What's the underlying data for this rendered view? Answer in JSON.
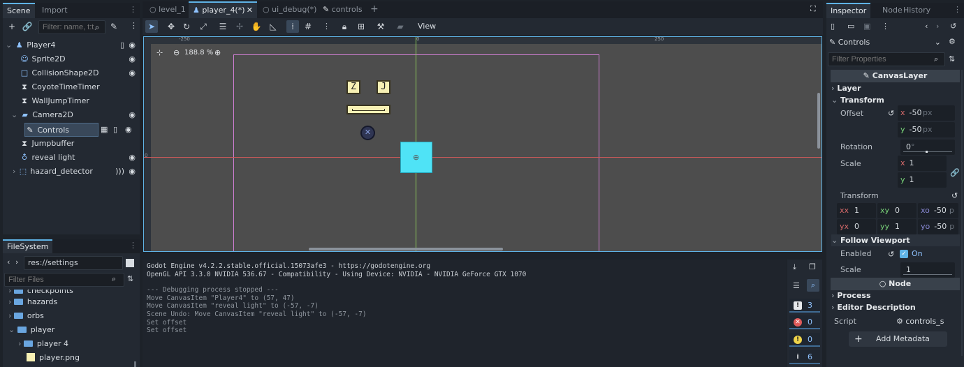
{
  "left_dock": {
    "tabs": [
      "Scene",
      "Import"
    ],
    "filter_placeholder": "Filter: name, t:t",
    "tree": [
      {
        "label": "Player4",
        "icon": "character-body-icon"
      },
      {
        "label": "Sprite2D",
        "icon": "sprite-icon"
      },
      {
        "label": "CollisionShape2D",
        "icon": "collision-shape-icon"
      },
      {
        "label": "CoyoteTimeTimer",
        "icon": "timer-icon"
      },
      {
        "label": "WallJumpTimer",
        "icon": "timer-icon"
      },
      {
        "label": "Camera2D",
        "icon": "camera-icon"
      },
      {
        "label": "Controls",
        "icon": "canvas-layer-icon"
      },
      {
        "label": "Jumpbuffer",
        "icon": "timer-icon"
      },
      {
        "label": "reveal light",
        "icon": "point-light-icon"
      },
      {
        "label": "hazard_detector",
        "icon": "area-icon"
      }
    ]
  },
  "filesystem": {
    "tab": "FileSystem",
    "path": "res://settings",
    "filter_placeholder": "Filter Files",
    "items": [
      {
        "label": "checkpoints"
      },
      {
        "label": "hazards"
      },
      {
        "label": "orbs"
      },
      {
        "label": "player"
      },
      {
        "label": "player 4"
      },
      {
        "label": "player.png"
      }
    ]
  },
  "editor_tabs": [
    "level_1",
    "player_4(*)",
    "ui_debug(*)",
    "controls"
  ],
  "toolbar": {
    "view_label": "View"
  },
  "viewport": {
    "zoom": "188.8 %",
    "ruler_labels": [
      "-250",
      "0",
      "250"
    ],
    "ruler_side": "0",
    "keys": [
      "Z",
      "J"
    ]
  },
  "output": {
    "lines": [
      "Godot Engine v4.2.2.stable.official.15073afe3 - https://godotengine.org",
      "OpenGL API 3.3.0 NVIDIA 536.67 - Compatibility - Using Device: NVIDIA - NVIDIA GeForce GTX 1070",
      "",
      "--- Debugging process stopped ---",
      "Move CanvasItem \"Player4\" to (57, 47)",
      "Move CanvasItem \"reveal light\" to (-57, -7)",
      "Scene Undo: Move CanvasItem \"reveal light\" to (-57, -7)",
      "Set offset",
      "Set offset"
    ],
    "counters": {
      "all": "3",
      "errors": "0",
      "warnings": "0",
      "messages": "6"
    }
  },
  "inspector": {
    "tabs": [
      "Inspector",
      "Node",
      "History"
    ],
    "object": "Controls",
    "filter_placeholder": "Filter Properties",
    "class_header": "CanvasLayer",
    "sections": {
      "layer": "Layer",
      "transform": "Transform",
      "follow": "Follow Viewport",
      "node": "Node",
      "process": "Process",
      "editor_desc": "Editor Description"
    },
    "offset": {
      "label": "Offset",
      "x": "-50",
      "y": "-50",
      "unit": "px"
    },
    "rotation": {
      "label": "Rotation",
      "value": "0",
      "unit": "°"
    },
    "scale": {
      "label": "Scale",
      "x": "1",
      "y": "1"
    },
    "transform": {
      "label": "Transform",
      "xx": "1",
      "xy": "0",
      "xo": "-50",
      "yx": "0",
      "yy": "1",
      "yo": "-50",
      "unit": "p"
    },
    "follow_enabled": {
      "label": "Enabled",
      "value": "On"
    },
    "follow_scale": {
      "label": "Scale",
      "value": "1"
    },
    "script": {
      "label": "Script",
      "value": "controls_s"
    },
    "add_metadata": "Add Metadata"
  },
  "colors": {
    "accent": "#5fb3e6",
    "viewport_bg": "#4d4d4d",
    "player_box": "#4fe3f6",
    "key_fill": "#f7f0b4"
  }
}
